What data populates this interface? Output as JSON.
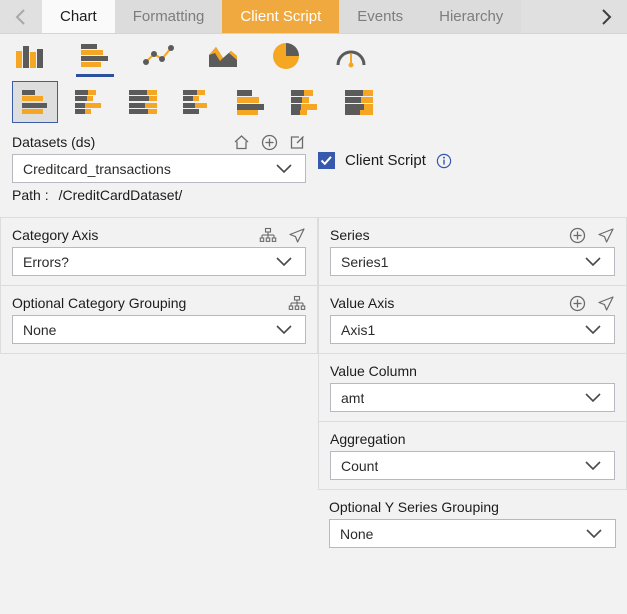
{
  "tabs": {
    "prev_label": "chevron-left",
    "next_label": "chevron-right",
    "items": [
      {
        "label": "Chart",
        "state": "active"
      },
      {
        "label": "Formatting",
        "state": "normal"
      },
      {
        "label": "Client Script",
        "state": "accent"
      },
      {
        "label": "Events",
        "state": "normal"
      },
      {
        "label": "Hierarchy",
        "state": "normal"
      }
    ]
  },
  "chart_types": [
    {
      "name": "column-chart-icon",
      "selected": false
    },
    {
      "name": "bar-chart-icon",
      "selected": true
    },
    {
      "name": "line-scatter-chart-icon",
      "selected": false
    },
    {
      "name": "area-chart-icon",
      "selected": false
    },
    {
      "name": "pie-chart-icon",
      "selected": false
    },
    {
      "name": "gauge-chart-icon",
      "selected": false
    }
  ],
  "chart_subtypes": [
    {
      "name": "bar-plain-icon",
      "selected": true
    },
    {
      "name": "bar-stacked-icon",
      "selected": false
    },
    {
      "name": "bar-stacked-100-icon",
      "selected": false
    },
    {
      "name": "bar-clustered-icon",
      "selected": false
    },
    {
      "name": "bar-3d-icon",
      "selected": false
    },
    {
      "name": "bar-3d-stacked-icon",
      "selected": false
    },
    {
      "name": "bar-3d-stacked-100-icon",
      "selected": false
    }
  ],
  "datasets": {
    "label": "Datasets (ds)",
    "home_icon": "home-icon",
    "add_icon": "add-circle-icon",
    "edit_icon": "edit-icon",
    "value": "Creditcard_transactions",
    "path_label": "Path :",
    "path_value": "/CreditCardDataset/"
  },
  "client_script": {
    "label": "Client Script",
    "checked": true,
    "info_icon": "info-icon"
  },
  "category_axis": {
    "label": "Category Axis",
    "hierarchy_icon": "hierarchy-icon",
    "send_icon": "send-icon",
    "value": "Errors?"
  },
  "category_grouping": {
    "label": "Optional Category Grouping",
    "hierarchy_icon": "hierarchy-icon",
    "value": "None"
  },
  "series": {
    "label": "Series",
    "add_icon": "add-circle-icon",
    "send_icon": "send-icon",
    "value": "Series1"
  },
  "value_axis": {
    "label": "Value Axis",
    "add_icon": "add-circle-icon",
    "send_icon": "send-icon",
    "value": "Axis1"
  },
  "value_column": {
    "label": "Value Column",
    "value": "amt"
  },
  "aggregation": {
    "label": "Aggregation",
    "value": "Count"
  },
  "y_series_grouping": {
    "label": "Optional Y Series Grouping",
    "value": "None"
  },
  "colors": {
    "accent_orange": "#f0a93f",
    "selection_blue": "#2c4f9e",
    "checkbox_blue": "#3858ad",
    "icon_gray": "#5b5b5b",
    "panel_bg": "#f2f2f2"
  }
}
